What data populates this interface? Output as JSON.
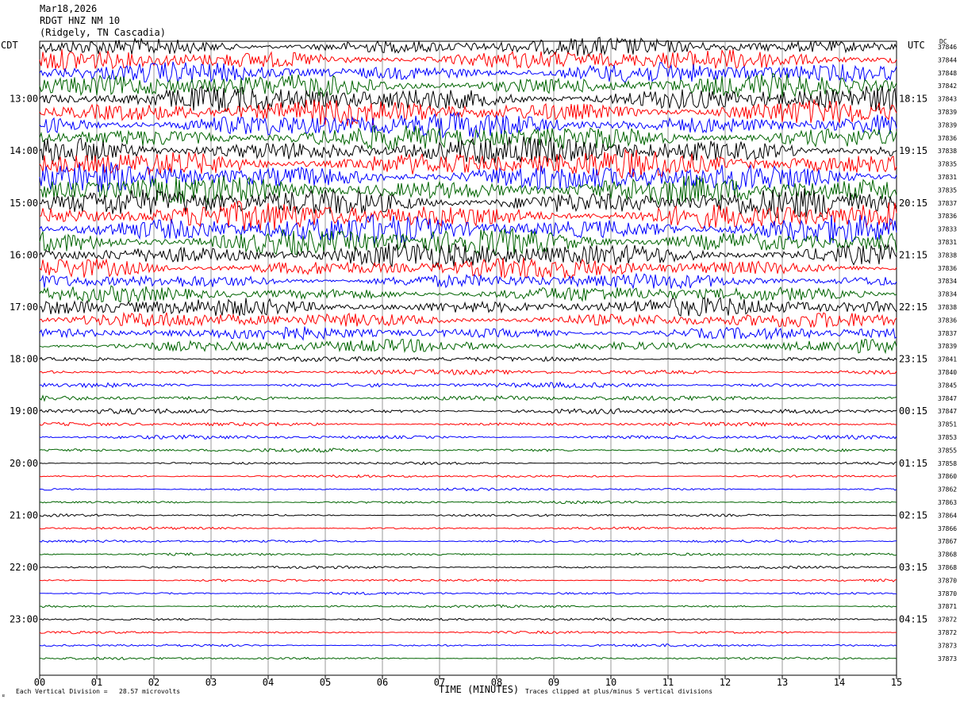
{
  "header": {
    "date": "Mar18,2026",
    "station": "RDGT HNZ NM 10",
    "location": "(Ridgely, TN Cascadia)"
  },
  "left_timezone": "CDT",
  "right_timezone": "UTC",
  "right_column_header": "DC",
  "footer": {
    "scale_note": "Each Vertical Division =   28.57 microvolts",
    "xlabel": "TIME (MINUTES)",
    "clip_note": "Traces clipped at plus/minus 5 vertical divisions",
    "corner_mark": "¤"
  },
  "colors": {
    "trace_cycle": [
      "#000000",
      "#ff0000",
      "#0000ff",
      "#006400"
    ],
    "grid": "#808080"
  },
  "chart_data": {
    "type": "helicorder",
    "xlabel": "TIME (MINUTES)",
    "xlim": [
      0,
      15
    ],
    "x_ticks": [
      "00",
      "01",
      "02",
      "03",
      "04",
      "05",
      "06",
      "07",
      "08",
      "09",
      "10",
      "11",
      "12",
      "13",
      "14",
      "15"
    ],
    "row_duration_minutes": 15,
    "rows_per_hour": 4,
    "left_hour_labels": [
      "13:00",
      "14:00",
      "15:00",
      "16:00",
      "17:00",
      "18:00",
      "19:00",
      "20:00",
      "21:00",
      "22:00",
      "23:00"
    ],
    "right_hour_labels": [
      "18:15",
      "19:15",
      "20:15",
      "21:15",
      "22:15",
      "23:15",
      "00:15",
      "01:15",
      "02:15",
      "03:15",
      "04:15"
    ],
    "first_labeled_row_index": 4,
    "dc_offsets": [
      37846,
      37844,
      37848,
      37842,
      37843,
      37839,
      37839,
      37836,
      37838,
      37835,
      37831,
      37835,
      37837,
      37836,
      37833,
      37831,
      37838,
      37836,
      37834,
      37834,
      37838,
      37836,
      37837,
      37839,
      37841,
      37840,
      37845,
      37847,
      37847,
      37851,
      37853,
      37855,
      37858,
      37860,
      37862,
      37863,
      37864,
      37866,
      37867,
      37868,
      37868,
      37870,
      37870,
      37871,
      37872,
      37872,
      37873,
      37873
    ],
    "amplitude_levels": [
      7,
      8,
      8,
      9,
      10,
      10,
      10,
      10,
      11,
      11,
      11,
      11,
      11,
      11,
      11,
      11,
      10,
      8,
      6,
      6,
      7,
      6,
      5,
      5,
      2,
      2,
      2,
      2,
      2,
      1.5,
      1.5,
      1.5,
      1,
      1,
      1,
      1,
      1,
      1,
      1,
      1,
      1,
      1,
      1,
      1,
      1,
      1,
      1,
      1
    ],
    "grid": true
  }
}
